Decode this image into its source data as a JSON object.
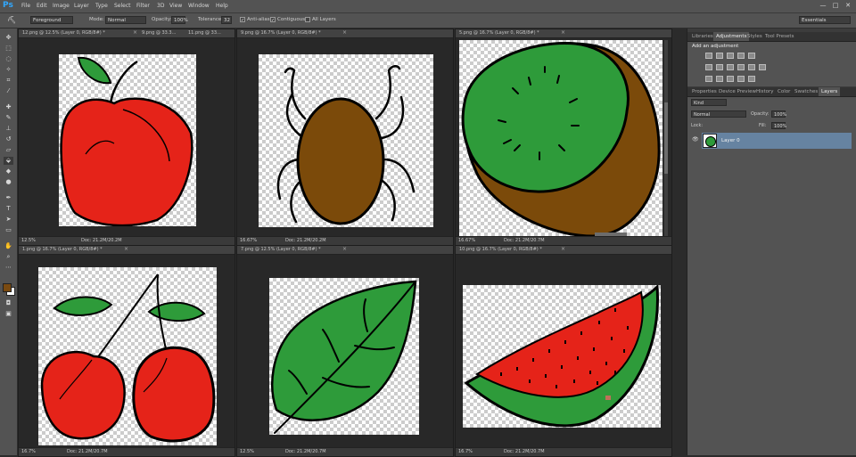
{
  "app": {
    "logo": "Ps"
  },
  "menu": [
    "File",
    "Edit",
    "Image",
    "Layer",
    "Type",
    "Select",
    "Filter",
    "3D",
    "View",
    "Window",
    "Help"
  ],
  "window_controls": {
    "minimize": "—",
    "maximize": "□",
    "close": "✕"
  },
  "options": {
    "preset": "Foreground",
    "mode_label": "Mode:",
    "mode_value": "Normal",
    "opacity_label": "Opacity:",
    "opacity_value": "100%",
    "tolerance_label": "Tolerance:",
    "tolerance_value": "32",
    "anti_alias": "Anti-alias",
    "contiguous": "Contiguous",
    "all_layers": "All Layers",
    "workspace": "Essentials"
  },
  "documents": [
    {
      "tab": "12.png @ 12.5% (Layer 0, RGB/8#) *",
      "zoom": "12.5%",
      "doc": "Doc: 21.2M/20.2M",
      "drawing": "apple"
    },
    {
      "tab": "9.png @ 16.7% (Layer 0, RGB/8#) *",
      "zoom": "16.67%",
      "doc": "Doc: 21.2M/20.2M",
      "drawing": "spider"
    },
    {
      "tab": "5.png @ 16.7% (Layer 0, RGB/8#) *",
      "zoom": "16.67%",
      "doc": "Doc: 21.2M/20.7M",
      "drawing": "kiwi"
    },
    {
      "tab": "1.png @ 16.7% (Layer 0, RGB/8#) *",
      "zoom": "16.7%",
      "doc": "Doc: 21.2M/20.7M",
      "drawing": "cherry"
    },
    {
      "tab": "7.png @ 12.5% (Layer 0, RGB/8#) *",
      "zoom": "12.5%",
      "doc": "Doc: 21.2M/20.7M",
      "drawing": "leaf"
    },
    {
      "tab": "10.png @ 16.7% (Layer 0, RGB/8#) *",
      "zoom": "16.7%",
      "doc": "Doc: 21.2M/20.7M",
      "drawing": "watermelon"
    }
  ],
  "extra_tabs": [
    "9.png @ 33.3...",
    "11.png @ 33..."
  ],
  "panels": {
    "top_tabs": [
      "Libraries",
      "Adjustments",
      "Styles",
      "Tool Presets"
    ],
    "active_top": "Adjustments",
    "adjust_heading": "Add an adjustment",
    "layer_tabs": [
      "Properties",
      "Device Preview",
      "History",
      "Color",
      "Swatches",
      "Layers"
    ],
    "active_layer": "Layers",
    "kind": "Kind",
    "blend": "Normal",
    "opacity_label": "Opacity:",
    "opacity_value": "100%",
    "lock_label": "Lock:",
    "fill_label": "Fill:",
    "fill_value": "100%",
    "layer_name": "Layer 0"
  },
  "colors": {
    "foreground": "#7a4a10",
    "background": "#ffffff",
    "selection": "#6683a1"
  }
}
